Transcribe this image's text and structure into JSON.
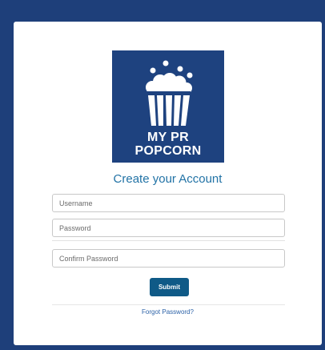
{
  "colors": {
    "page_background": "#1e3f7a",
    "logo_background": "#1e427f",
    "title_color": "#2273a6",
    "submit_color": "#0f5a87",
    "link_color": "#2d63a8"
  },
  "logo": {
    "icon": "popcorn-icon",
    "line1": "MY PR",
    "line2": "POPCORN"
  },
  "form": {
    "title": "Create your Account",
    "username_placeholder": "Username",
    "password_placeholder": "Password",
    "confirm_placeholder": "Confirm Password",
    "submit_label": "Submit",
    "forgot_link": "Forgot Password?"
  }
}
